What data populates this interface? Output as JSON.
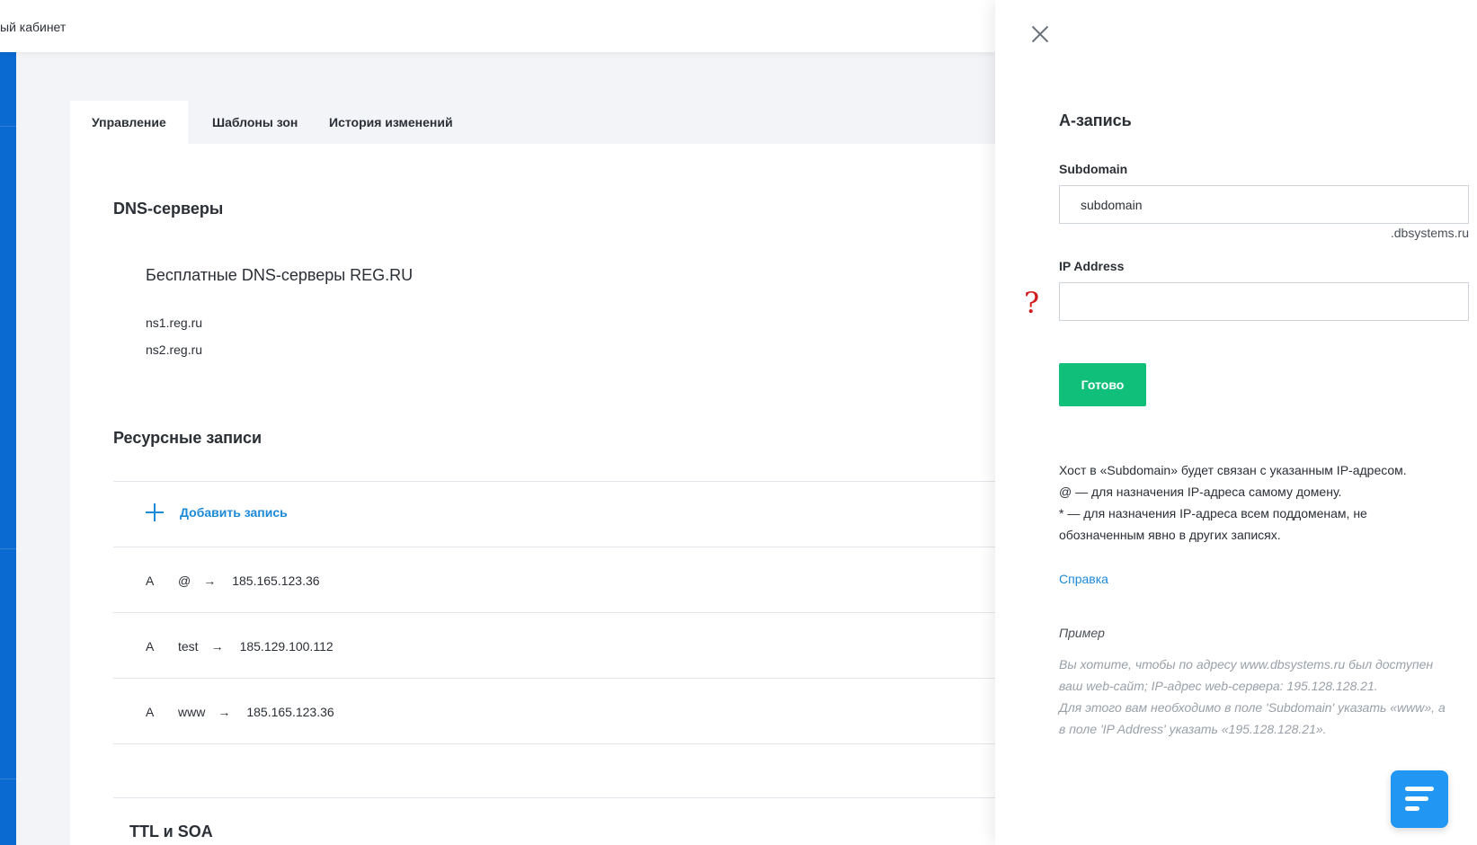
{
  "topbar": {
    "crumb": "ый кабинет",
    "under_title": " "
  },
  "tabs": [
    {
      "label": "Управление"
    },
    {
      "label": "Шаблоны зон"
    },
    {
      "label": "История изменений"
    }
  ],
  "dns": {
    "title": "DNS-серверы",
    "provider": "Бесплатные DNS-серверы REG.RU",
    "servers": [
      "ns1.reg.ru",
      "ns2.reg.ru"
    ]
  },
  "records": {
    "title": "Ресурсные записи",
    "add_label": "Добавить запись",
    "arrow": "→",
    "items": [
      {
        "type": "A",
        "host": "@",
        "value": "185.165.123.36"
      },
      {
        "type": "A",
        "host": "test",
        "value": "185.129.100.112"
      },
      {
        "type": "A",
        "host": "www",
        "value": "185.165.123.36"
      }
    ]
  },
  "ttl": {
    "title": "TTL и SOA"
  },
  "panel": {
    "title": "А-запись",
    "subdomain_label": "Subdomain",
    "subdomain_value": "subdomain",
    "suffix": ".dbsystems.ru",
    "ip_label": "IP Address",
    "ip_value": "",
    "qmark": "?",
    "done_label": "Готово",
    "help_lines": [
      "Хост в «Subdomain» будет связан с указанным IP-адресом.",
      "@ — для назначения IP-адреса самому домену.",
      "* — для назначения IP-адреса всем поддоменам, не",
      "обозначенным явно в других записях."
    ],
    "help_link": "Справка",
    "example_title": "Пример",
    "example_lines": [
      "Вы хотите, чтобы по адресу www.dbsystems.ru был доступен",
      "ваш web-сайт; IP-адрес web-сервера: 195.128.128.21.",
      "Для этого вам необходимо в поле 'Subdomain' указать «www», а",
      "в поле 'IP Address' указать «195.128.128.21»."
    ]
  },
  "colors": {
    "accent": "#1d8ad8",
    "primary_button": "#10c07a",
    "rail": "#0a6ad1",
    "question_mark": "#d01a1a"
  }
}
